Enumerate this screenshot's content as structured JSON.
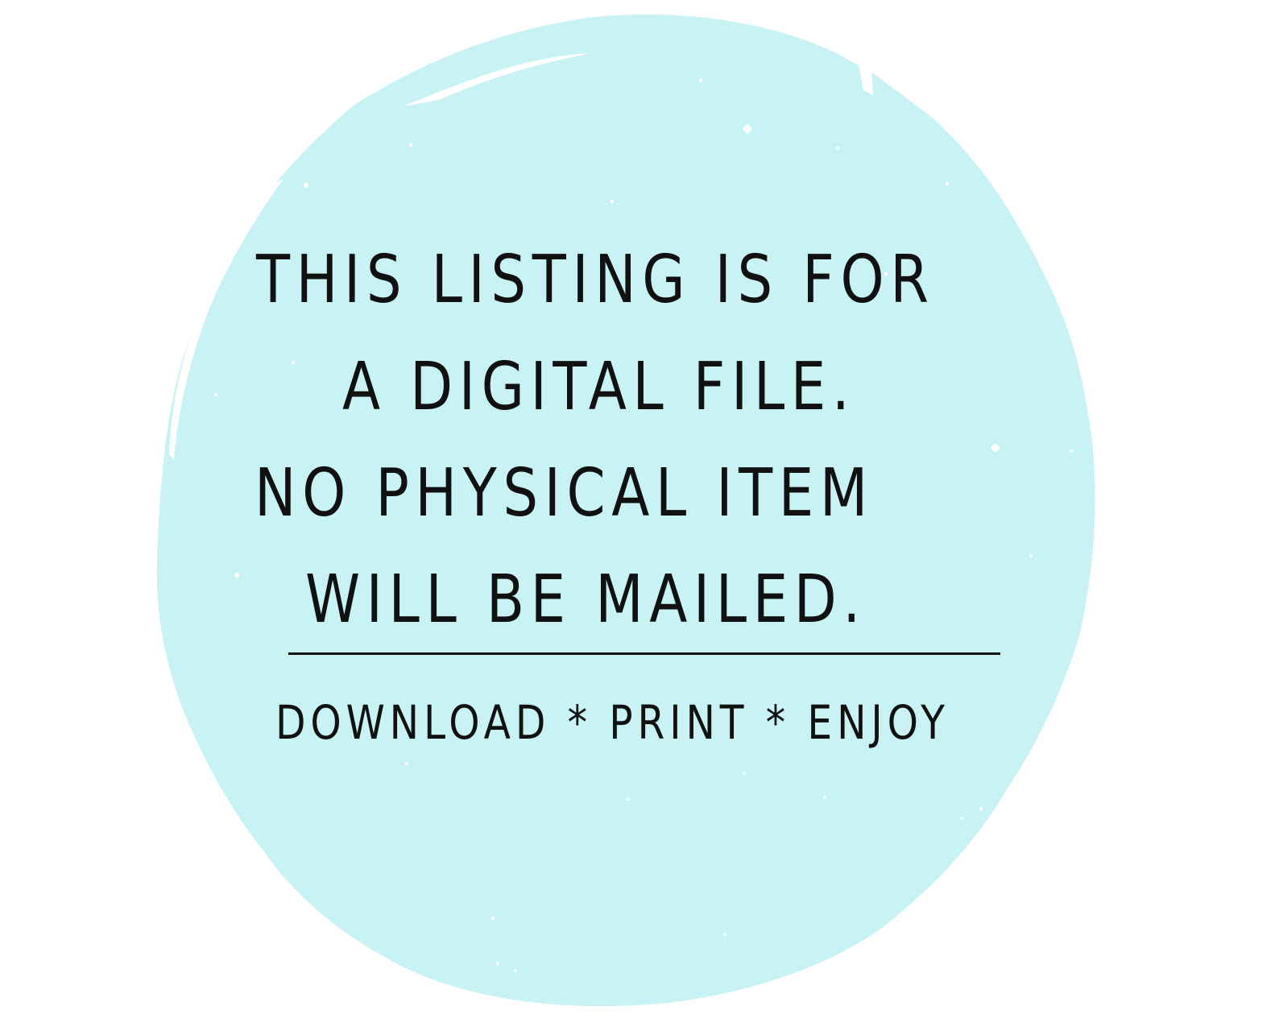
{
  "notice": {
    "lines": [
      "THIS LISTING IS FOR",
      "A DIGITAL FILE.",
      "NO PHYSICAL ITEM",
      "WILL BE MAILED."
    ],
    "tagline": "DOWNLOAD * PRINT * ENJOY"
  },
  "colors": {
    "background": "#ffffff",
    "blob": "#c8f2f4",
    "text": "#111111"
  }
}
